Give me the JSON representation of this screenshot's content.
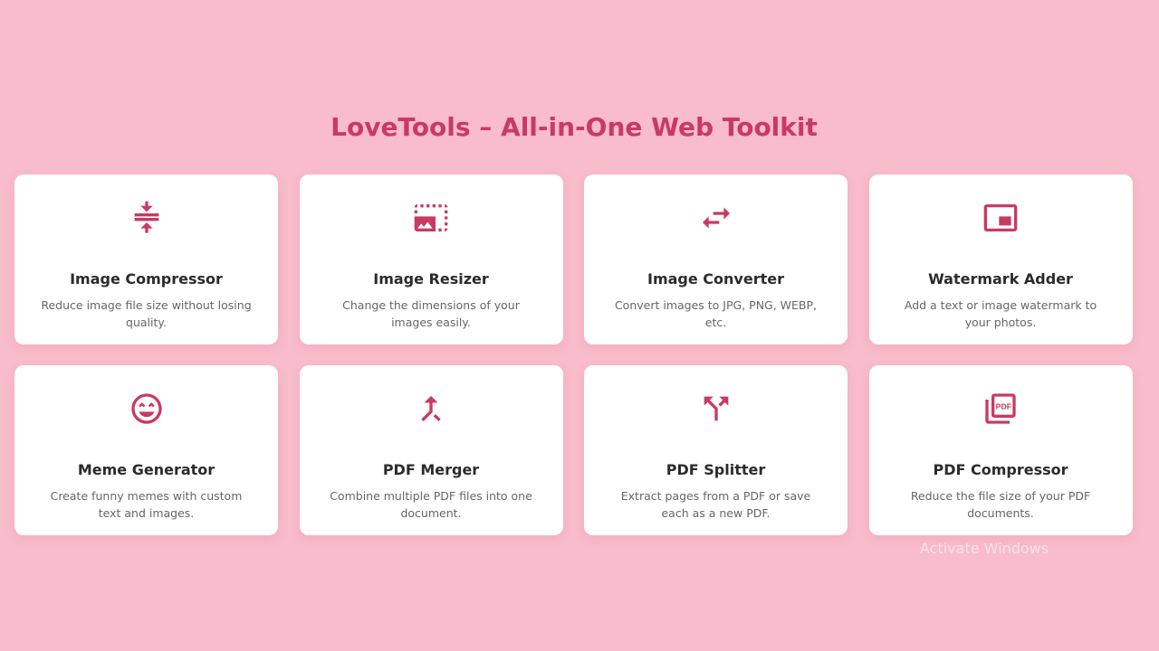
{
  "page": {
    "title": "LoveTools – All-in-One Web Toolkit",
    "accent_color": "#c93a63",
    "background_color": "#f8bccb"
  },
  "tools": [
    {
      "name": "Image Compressor",
      "description": "Reduce image file size without losing quality.",
      "icon": "compress-icon"
    },
    {
      "name": "Image Resizer",
      "description": "Change the dimensions of your images easily.",
      "icon": "photo-size-select-icon"
    },
    {
      "name": "Image Converter",
      "description": "Convert images to JPG, PNG, WEBP, etc.",
      "icon": "swap-arrows-icon"
    },
    {
      "name": "Watermark Adder",
      "description": "Add a text or image watermark to your photos.",
      "icon": "picture-in-picture-icon"
    },
    {
      "name": "Meme Generator",
      "description": "Create funny memes with custom text and images.",
      "icon": "smiley-face-icon"
    },
    {
      "name": "PDF Merger",
      "description": "Combine multiple PDF files into one document.",
      "icon": "merge-icon"
    },
    {
      "name": "PDF Splitter",
      "description": "Extract pages from a PDF or save each as a new PDF.",
      "icon": "split-icon"
    },
    {
      "name": "PDF Compressor",
      "description": "Reduce the file size of your PDF documents.",
      "icon": "pdf-icon"
    }
  ],
  "os_watermark": "Activate Windows"
}
